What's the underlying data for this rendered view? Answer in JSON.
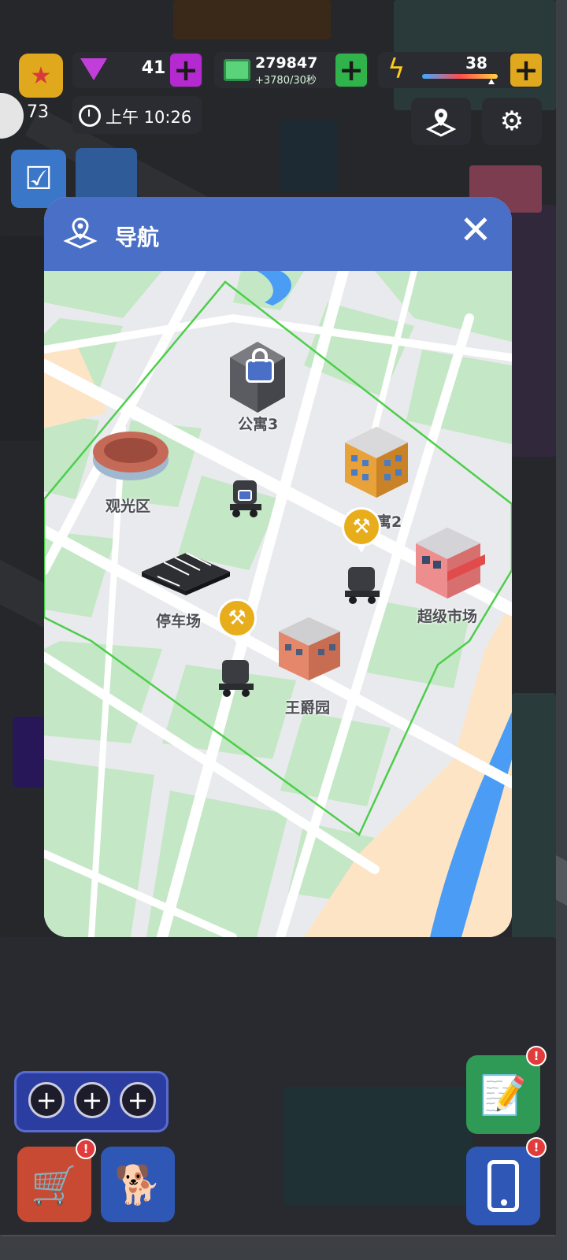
{
  "hud": {
    "gems": "41",
    "cash": "279847",
    "cash_rate": "+3780/30秒",
    "energy": "38",
    "level": "73",
    "time": "上午 10:26"
  },
  "modal": {
    "title": "导航",
    "close_symbol": "✕",
    "map_labels": {
      "apartment3": "公寓3",
      "sightseeing": "观光区",
      "apartment2": "寓2",
      "parking": "停车场",
      "supermarket": "超级市场",
      "royal_garden": "王爵园"
    }
  },
  "icons": {
    "navigation": "map-pin-icon",
    "settings": "gear-icon",
    "map": "map-icon",
    "task": "checklist-icon",
    "cart": "cart-icon",
    "dog": "dog-icon",
    "notes": "notepad-icon",
    "phone": "phone-icon",
    "construction": "construction-worker-icon",
    "lock": "lock-icon"
  },
  "alerts": {
    "cart": "!",
    "notes": "!",
    "phone": "!"
  },
  "colors": {
    "header": "#4a6fc6",
    "park": "#c4e7c5",
    "road": "#ffffff",
    "water": "#4a9cf5",
    "sand": "#fde4c5",
    "boundary": "#4ccf4a",
    "marker": "#e8ad1a"
  }
}
